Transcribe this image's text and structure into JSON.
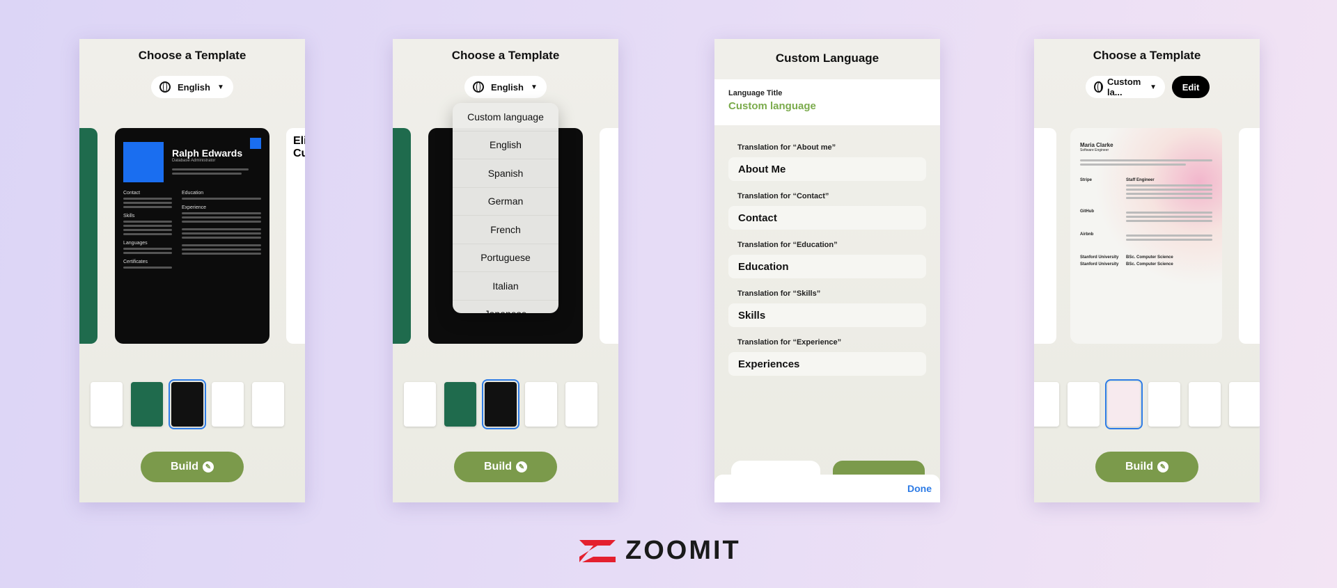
{
  "screens": [
    {
      "title": "Choose a Template",
      "language": "English",
      "build": "Build",
      "resume": {
        "name": "Ralph Edwards",
        "role": "Database Administrator",
        "sections": [
          "Contact",
          "Education",
          "Experience",
          "Skills",
          "Languages",
          "Certificates"
        ],
        "side_peek": "Eli Cu"
      }
    },
    {
      "title": "Choose a Template",
      "language": "English",
      "build": "Build",
      "dropdown": [
        "Custom language",
        "English",
        "Spanish",
        "German",
        "French",
        "Portuguese",
        "Italian",
        "Japanese"
      ]
    },
    {
      "title": "Custom Language",
      "language_title_label": "Language Title",
      "language_title_value": "Custom language",
      "fields": [
        {
          "label": "Translation for “About me”",
          "value": "About Me"
        },
        {
          "label": "Translation for “Contact”",
          "value": "Contact"
        },
        {
          "label": "Translation for “Education”",
          "value": "Education"
        },
        {
          "label": "Translation for “Skills”",
          "value": "Skills"
        },
        {
          "label": "Translation for “Experience”",
          "value": "Experiences"
        }
      ],
      "done": "Done"
    },
    {
      "title": "Choose a Template",
      "language": "Custom la...",
      "edit": "Edit",
      "build": "Build",
      "resume": {
        "name": "Maria Clarke",
        "role": "Software Engineer",
        "companies": [
          "Stripe",
          "GitHub",
          "Airbnb"
        ],
        "education": [
          "Stanford University",
          "Stanford University"
        ],
        "degree": "BSc. Computer Science",
        "job_title": "Staff Engineer"
      }
    }
  ],
  "logo": "ZOOMIT",
  "colors": {
    "build": "#7b9a4b",
    "accent_blue": "#2d7be5",
    "logo_red": "#e4202e"
  }
}
